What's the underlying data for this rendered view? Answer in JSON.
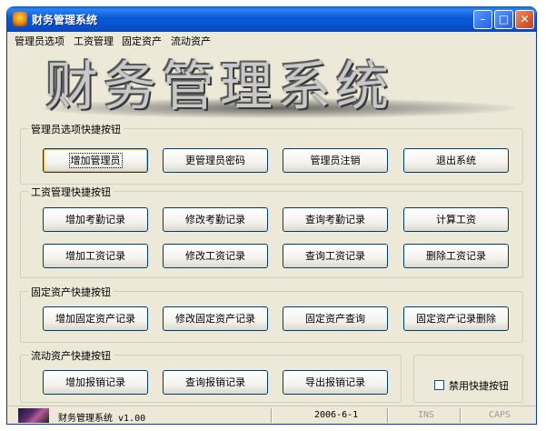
{
  "window": {
    "title": "财务管理系统",
    "minimize_glyph": "–",
    "maximize_glyph": "□",
    "close_glyph": "✕"
  },
  "menu": [
    "管理员选项",
    "工资管理",
    "固定资产",
    "流动资产"
  ],
  "banner": "财务管理系统",
  "admin": {
    "title": "管理员选项快捷按钮",
    "buttons": [
      "增加管理员",
      "更管理员密码",
      "管理员注销",
      "退出系统"
    ]
  },
  "salary": {
    "title": "工资管理快捷按钮",
    "row1": [
      "增加考勤记录",
      "修改考勤记录",
      "查询考勤记录",
      "计算工资"
    ],
    "row2": [
      "增加工资记录",
      "修改工资记录",
      "查询工资记录",
      "删除工资记录"
    ]
  },
  "fixed": {
    "title": "固定资产快捷按钮",
    "buttons": [
      "增加固定资产记录",
      "修改固定资产记录",
      "固定资产查询",
      "固定资产记录删除"
    ]
  },
  "current": {
    "title": "流动资产快捷按钮",
    "buttons": [
      "增加报销记录",
      "查询报销记录",
      "导出报销记录"
    ]
  },
  "disable_shortcut": {
    "label": "禁用快捷按钮",
    "checked": false
  },
  "status": {
    "app": "财务管理系统 v1.00",
    "date": "2006-6-1",
    "ins": "INS",
    "caps": "CAPS"
  },
  "colors": {
    "title_bar": "#0a5fd8",
    "window_bg": "#ece9d8",
    "button_border": "#003c74"
  }
}
